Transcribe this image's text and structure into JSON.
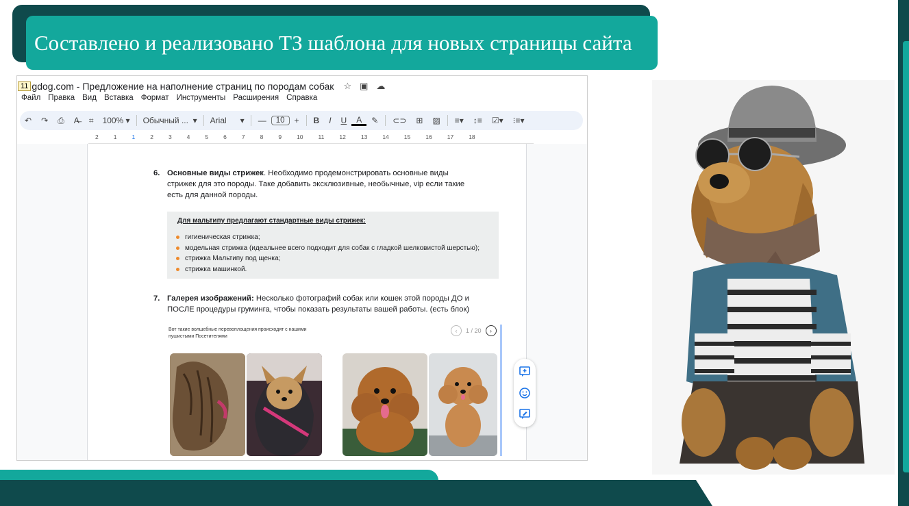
{
  "slide": {
    "title": "Составлено и реализовано ТЗ шаблона для новых страницы сайта",
    "colors": {
      "teal": "#13a89c",
      "dark_teal": "#0f4a4c"
    }
  },
  "doc": {
    "page_badge": "11",
    "title": "gdog.com - Предложение на наполнение страниц по породам собак",
    "title_icons": [
      "star-icon",
      "folder-move-icon",
      "cloud-status-icon"
    ],
    "menu": [
      "Файл",
      "Правка",
      "Вид",
      "Вставка",
      "Формат",
      "Инструменты",
      "Расширения",
      "Справка"
    ],
    "toolbar": {
      "zoom": "100%",
      "style": "Обычный ...",
      "font": "Arial",
      "font_size": "10",
      "minus": "—",
      "plus": "+",
      "bold": "B",
      "italic": "I",
      "underline": "U",
      "text_color": "A"
    },
    "ruler_ticks": [
      "2",
      "1",
      "1",
      "2",
      "3",
      "4",
      "5",
      "6",
      "7",
      "8",
      "9",
      "10",
      "11",
      "12",
      "13",
      "14",
      "15",
      "16",
      "17",
      "18"
    ],
    "item6": {
      "number": "6.",
      "heading": "Основные виды стрижек",
      "text": ". Необходимо продемонстрировать основные виды стрижек для это породы. Таке добавить эксклюзивные, необычные, vip если такие есть для данной породы."
    },
    "box": {
      "heading": "Для мальтипу предлагают стандартные виды стрижек:",
      "bullets": [
        "гигиеническая стрижка;",
        "модельная стрижка (идеальнее всего подходит для собак с гладкой шелковистой шерстью);",
        "стрижка Мальтипу под щенка;",
        "стрижка машинкой."
      ],
      "bullet_color": "#ee8a2b"
    },
    "item7": {
      "number": "7.",
      "heading": "Галерея изображений:",
      "text": " Несколько фотографий собак или кошек этой породы ДО и ПОСЛЕ процедуры груминга, чтобы показать результаты вашей работы. (есть блок)"
    },
    "gallery": {
      "caption": "Вот такие волшебные перевоплощения происходят с нашими пушистыми Посетителями",
      "counter": "1 / 20"
    },
    "side_actions": [
      "add-comment-icon",
      "emoji-reaction-icon",
      "suggest-edit-icon"
    ]
  }
}
